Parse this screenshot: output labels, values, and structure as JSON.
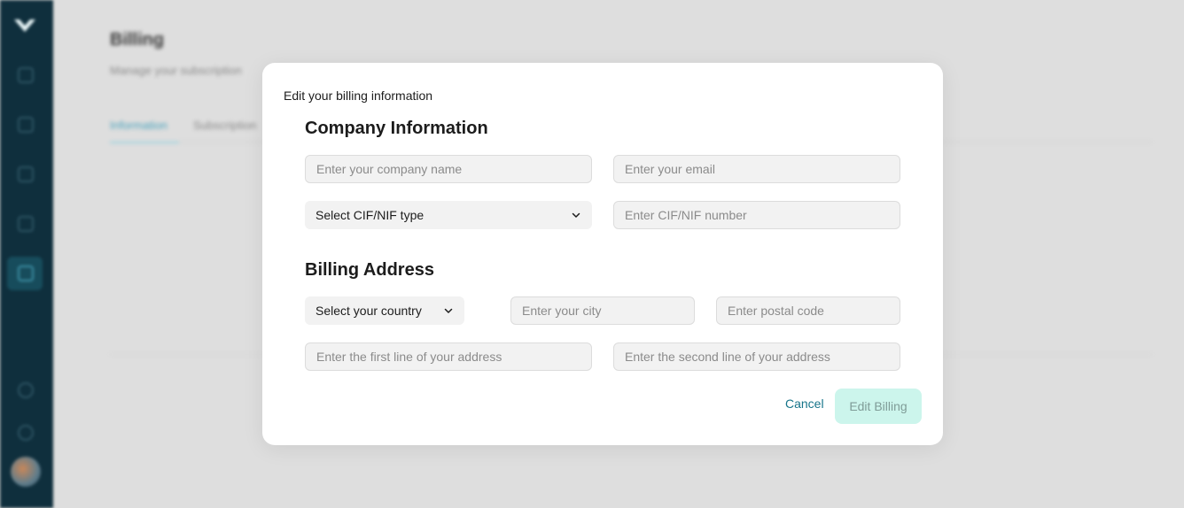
{
  "background": {
    "page_title": "Billing",
    "page_subtitle": "Manage your subscription",
    "tabs": [
      {
        "label": "Information"
      },
      {
        "label": "Subscription"
      }
    ]
  },
  "modal": {
    "title": "Edit your billing information",
    "company_section": {
      "heading": "Company Information",
      "company_name_placeholder": "Enter your company name",
      "email_placeholder": "Enter your email",
      "cif_type_select": "Select CIF/NIF type",
      "cif_number_placeholder": "Enter CIF/NIF number"
    },
    "address_section": {
      "heading": "Billing Address",
      "country_select": "Select your country",
      "city_placeholder": "Enter your city",
      "postal_placeholder": "Enter postal code",
      "address1_placeholder": "Enter the first line of your address",
      "address2_placeholder": "Enter the second line of your address"
    },
    "actions": {
      "cancel_label": "Cancel",
      "submit_label": "Edit Billing"
    }
  },
  "colors": {
    "sidebar_bg": "#0f2f3d",
    "accent_teal": "#17758a",
    "submit_bg_disabled": "#ccf5ec"
  },
  "icons": [
    "logo-icon",
    "chat-icon",
    "document-icon",
    "chart-icon",
    "book-icon",
    "billing-icon",
    "help-icon",
    "settings-icon",
    "chevron-down-icon"
  ]
}
